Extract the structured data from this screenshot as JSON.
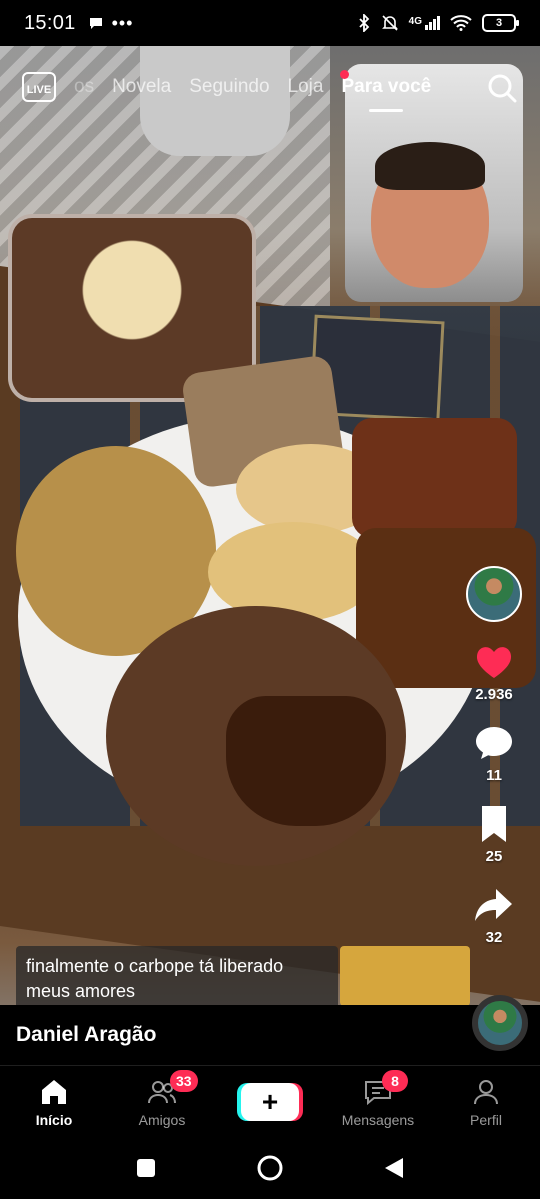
{
  "status_bar": {
    "time": "15:01",
    "left_icons": [
      "chat-bubble-icon",
      "more-dots-icon"
    ],
    "right_icons": [
      "bluetooth-icon",
      "bell-muted-icon",
      "signal-4g-icon",
      "wifi-icon"
    ],
    "network": "4G",
    "battery": "3"
  },
  "top_nav": {
    "live_label": "LIVE",
    "tabs": [
      {
        "label": "os"
      },
      {
        "label": "Novela"
      },
      {
        "label": "Seguindo"
      },
      {
        "label": "Loja"
      },
      {
        "label": "Para você"
      }
    ],
    "active_tab": "Para você"
  },
  "video": {
    "caption_line1": "finalmente o carbope tá liberado",
    "caption_line2": "meus amores",
    "author": "Daniel Aragão"
  },
  "actions": {
    "likes": "2.936",
    "comments": "11",
    "saves": "25",
    "shares": "32"
  },
  "bottom_nav": {
    "items": [
      {
        "label": "Início",
        "icon": "home-icon"
      },
      {
        "label": "Amigos",
        "icon": "friends-icon",
        "badge": "33"
      },
      {
        "label": "",
        "icon": "plus-icon"
      },
      {
        "label": "Mensagens",
        "icon": "inbox-icon",
        "badge": "8"
      },
      {
        "label": "Perfil",
        "icon": "profile-icon"
      }
    ]
  },
  "colors": {
    "accent_red": "#fe2c55",
    "accent_cyan": "#25f4ee",
    "background": "#000000"
  }
}
